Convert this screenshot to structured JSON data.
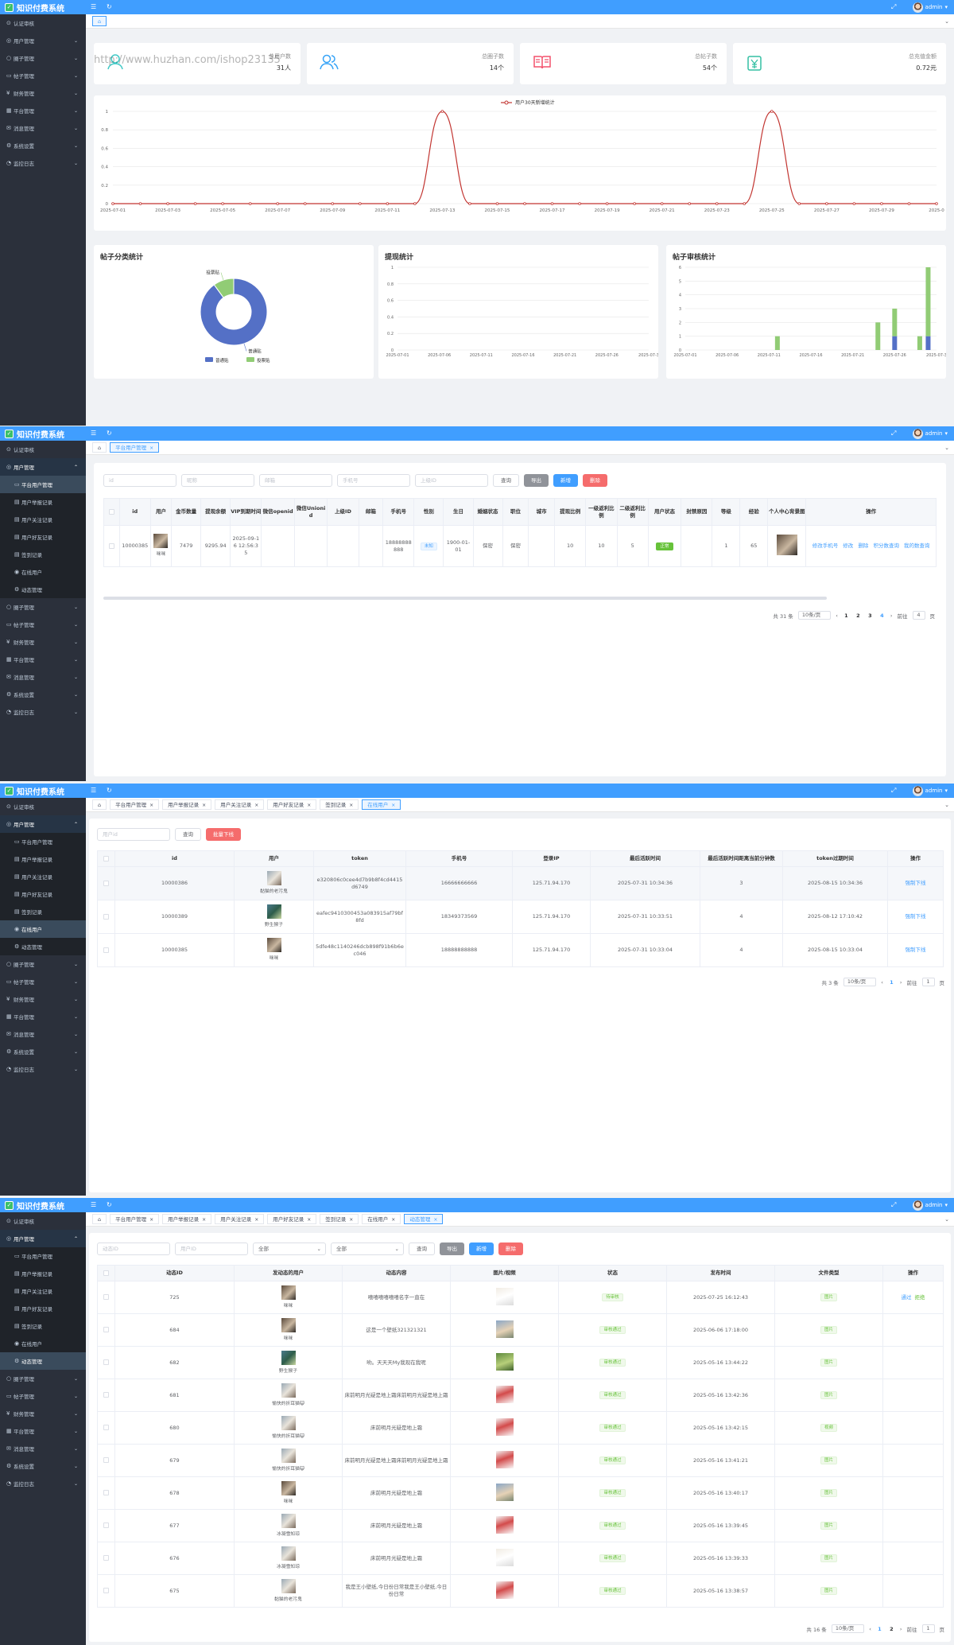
{
  "app": {
    "title": "知识付费系统",
    "user": "admin"
  },
  "menu": {
    "top": [
      "认证审核",
      "用户管理",
      "圈子管理",
      "帖子管理",
      "财务管理",
      "平台管理",
      "消息管理",
      "系统设置",
      "监控日志"
    ],
    "user_sub": [
      "平台用户管理",
      "用户举报记录",
      "用户关注记录",
      "用户好友记录",
      "签到记录",
      "在线用户",
      "动态管理"
    ]
  },
  "tabs": {
    "home_icon": "home-icon",
    "labels": [
      "平台用户管理",
      "用户举报记录",
      "用户关注记录",
      "用户好友记录",
      "签到记录",
      "在线用户",
      "动态管理"
    ]
  },
  "dashboard": {
    "stats": [
      {
        "label": "总用户数",
        "value": "31人",
        "icon": "user-icon",
        "color": "#40c9c6"
      },
      {
        "label": "总圈子数",
        "value": "14个",
        "icon": "users-icon",
        "color": "#36a3f7"
      },
      {
        "label": "总帖子数",
        "value": "54个",
        "icon": "book-icon",
        "color": "#f4516c"
      },
      {
        "label": "总充值金额",
        "value": "0.72元",
        "icon": "money-icon",
        "color": "#34bfa3"
      }
    ],
    "pie_title": "帖子分类统计",
    "withdraw_title": "提现统计",
    "audit_title": "帖子审核统计"
  },
  "chart_data": [
    {
      "type": "line",
      "legend": "用户30天新增统计",
      "x": [
        "2025-07-01",
        "2025-07-02",
        "2025-07-03",
        "2025-07-04",
        "2025-07-05",
        "2025-07-06",
        "2025-07-07",
        "2025-07-08",
        "2025-07-09",
        "2025-07-10",
        "2025-07-11",
        "2025-07-12",
        "2025-07-13",
        "2025-07-14",
        "2025-07-15",
        "2025-07-16",
        "2025-07-17",
        "2025-07-18",
        "2025-07-19",
        "2025-07-20",
        "2025-07-21",
        "2025-07-22",
        "2025-07-23",
        "2025-07-24",
        "2025-07-25",
        "2025-07-26",
        "2025-07-27",
        "2025-07-28",
        "2025-07-29",
        "2025-07-30",
        "2025-07-31"
      ],
      "x_tick_labels": [
        "2025-07-01",
        "2025-07-03",
        "2025-07-05",
        "2025-07-07",
        "2025-07-09",
        "2025-07-11",
        "2025-07-13",
        "2025-07-15",
        "2025-07-17",
        "2025-07-19",
        "2025-07-21",
        "2025-07-23",
        "2025-07-25",
        "2025-07-27",
        "2025-07-29",
        "2025-0"
      ],
      "values": [
        0,
        0,
        0,
        0,
        0,
        0,
        0,
        0,
        0,
        0,
        0,
        0,
        1,
        0,
        0,
        0,
        0,
        0,
        0,
        0,
        0,
        0,
        0,
        0,
        1,
        0,
        0,
        0,
        0,
        0,
        0
      ],
      "ylim": [
        0,
        1
      ],
      "y_ticks": [
        "0",
        "0.2",
        "0.4",
        "0.6",
        "0.8",
        "1"
      ],
      "color": "#c23531"
    },
    {
      "type": "pie",
      "labels": [
        "普通贴",
        "投票贴"
      ],
      "values": [
        90,
        10
      ],
      "colors": [
        "#5470c6",
        "#91cc75"
      ]
    },
    {
      "type": "line",
      "x_tick_labels": [
        "2025-07-01",
        "2025-07-06",
        "2025-07-11",
        "2025-07-16",
        "2025-07-21",
        "2025-07-26",
        "2025-07-3"
      ],
      "y_ticks": [
        "0",
        "0.2",
        "0.4",
        "0.6",
        "0.8",
        "1"
      ],
      "ylim": [
        0,
        1
      ],
      "values": []
    },
    {
      "type": "bar",
      "stacked": true,
      "x_tick_labels": [
        "2025-07-01",
        "2025-07-06",
        "2025-07-11",
        "2025-07-16",
        "2025-07-21",
        "2025-07-26",
        "2025-07-3"
      ],
      "categories_count": 31,
      "ylim": [
        0,
        6
      ],
      "y_ticks": [
        "0",
        "1",
        "2",
        "3",
        "4",
        "5",
        "6"
      ],
      "series": [
        {
          "color": "#5470c6",
          "points": [
            {
              "i": 25,
              "v": 1
            },
            {
              "i": 29,
              "v": 1
            }
          ]
        },
        {
          "color": "#91cc75",
          "points": [
            {
              "i": 11,
              "v": 1
            },
            {
              "i": 23,
              "v": 2
            },
            {
              "i": 25,
              "v": 2
            },
            {
              "i": 28,
              "v": 1
            },
            {
              "i": 29,
              "v": 5
            }
          ]
        }
      ]
    }
  ],
  "user_mgmt": {
    "placeholders": [
      "id",
      "昵称",
      "邮箱",
      "手机号",
      "上级ID"
    ],
    "buttons": {
      "query": "查询",
      "export": "导出",
      "add": "新增",
      "delete": "删除"
    },
    "columns": [
      "id",
      "用户",
      "金币数量",
      "提现余额",
      "VIP到期时间",
      "微信openid",
      "微信Unionid",
      "上级ID",
      "邮箱",
      "手机号",
      "性别",
      "生日",
      "婚姻状态",
      "职位",
      "城市",
      "提现比例",
      "一级返利比例",
      "二级返利比例",
      "用户状态",
      "封禁原因",
      "等级",
      "经验",
      "个人中心背景图",
      "操作"
    ],
    "row": {
      "id": "10000385",
      "nick": "咪咪",
      "coins": "7479",
      "balance": "9295.94",
      "vip": "2025-09-16 12:56:35",
      "phone": "18888888888",
      "gender": "未知",
      "birthday": "1900-01-01",
      "marriage": "保密",
      "job": "保密",
      "rate": "10",
      "rate1": "10",
      "rate2": "5",
      "status": "正常",
      "level": "1",
      "exp": "65"
    },
    "actions": [
      "修改手机号",
      "修改",
      "删除",
      "积分数查询",
      "我的数查询"
    ],
    "pager": {
      "total": "共 31 条",
      "size": "10条/页",
      "pages": [
        "1",
        "2",
        "3",
        "4"
      ],
      "goto": "前往",
      "page": "4",
      "unit": "页"
    }
  },
  "online": {
    "placeholder": "用户id",
    "buttons": {
      "query": "查询",
      "kick": "批量下线"
    },
    "columns": [
      "id",
      "用户",
      "token",
      "手机号",
      "登录IP",
      "最后活跃时间",
      "最后活跃时间距离当前分钟数",
      "token过期时间",
      "操作"
    ],
    "rows": [
      {
        "id": "10000386",
        "name": "黏猫的老污鬼",
        "token": "e320806c0cee4d7b9b8f4cd4415d6749",
        "phone": "16666666666",
        "ip": "125.71.94.170",
        "last": "2025-07-31 10:34:36",
        "mins": "3",
        "exp": "2025-08-15 10:34:36"
      },
      {
        "id": "10000389",
        "name": "野生猴子",
        "token": "eafec9410300453a083915af79bf8fd",
        "phone": "18349373569",
        "ip": "125.71.94.170",
        "last": "2025-07-31 10:33:51",
        "mins": "4",
        "exp": "2025-08-12 17:10:42"
      },
      {
        "id": "10000385",
        "name": "咪咪",
        "token": "5dfe48c1140246dcb898f91b6b6ec046",
        "phone": "18888888888",
        "ip": "125.71.94.170",
        "last": "2025-07-31 10:33:04",
        "mins": "4",
        "exp": "2025-08-15 10:33:04"
      }
    ],
    "action": "强制下线",
    "pager": {
      "total": "共 3 条",
      "size": "10条/页",
      "pages": [
        "1"
      ],
      "goto": "前往",
      "page": "1",
      "unit": "页"
    }
  },
  "dynamic": {
    "placeholders": [
      "动态ID",
      "用户ID"
    ],
    "selects": [
      "全部",
      "全部"
    ],
    "buttons": {
      "query": "查询",
      "export": "导出",
      "add": "新增",
      "delete": "删除"
    },
    "columns": [
      "动态ID",
      "发动态的用户",
      "动态内容",
      "图片/视频",
      "状态",
      "发布时间",
      "文件类型",
      "操作"
    ],
    "rows": [
      {
        "id": "725",
        "user": "咪咪",
        "text": "嘻嘻嘻嘻嘻嘻名字一直在",
        "status": "待审核",
        "time": "2025-07-25 16:12:43",
        "type": "图片",
        "ops": [
          "通过",
          "拒绝"
        ]
      },
      {
        "id": "684",
        "user": "咪咪",
        "text": "这是一个壁纸321321321",
        "status": "审核通过",
        "time": "2025-06-06 17:18:00",
        "type": "图片",
        "ops": []
      },
      {
        "id": "682",
        "user": "野生猴子",
        "text": "哟。天天天My我现在我呢",
        "status": "审核通过",
        "time": "2025-05-16 13:44:22",
        "type": "图片",
        "ops": []
      },
      {
        "id": "681",
        "user": "愉快的折耳猫😺",
        "text": "床前明月光疑是地上霜床前明月光疑是地上霜",
        "status": "审核通过",
        "time": "2025-05-16 13:42:36",
        "type": "图片",
        "ops": []
      },
      {
        "id": "680",
        "user": "愉快的折耳猫😺",
        "text": "床前明月光疑是地上霜",
        "status": "审核通过",
        "time": "2025-05-16 13:42:15",
        "type": "视频",
        "ops": []
      },
      {
        "id": "679",
        "user": "愉快的折耳猫😺",
        "text": "床前明月光疑是地上霜床前明月光疑是地上霜",
        "status": "审核通过",
        "time": "2025-05-16 13:41:21",
        "type": "图片",
        "ops": []
      },
      {
        "id": "678",
        "user": "咪咪",
        "text": "床前明月光疑是地上霜",
        "status": "审核通过",
        "time": "2025-05-16 13:40:17",
        "type": "图片",
        "ops": []
      },
      {
        "id": "677",
        "user": "冰凝雪知琼",
        "text": "床前明月光疑是地上霜",
        "status": "审核通过",
        "time": "2025-05-16 13:39:45",
        "type": "图片",
        "ops": []
      },
      {
        "id": "676",
        "user": "冰凝雪知琼",
        "text": "床前明月光疑是地上霜",
        "status": "审核通过",
        "time": "2025-05-16 13:39:33",
        "type": "图片",
        "ops": []
      },
      {
        "id": "675",
        "user": "黏猫的老污鬼",
        "text": "我是王小壁纸,今日份日常我是王小壁纸,今日份日常",
        "status": "审核通过",
        "time": "2025-05-16 13:38:57",
        "type": "图片",
        "ops": []
      }
    ],
    "pager": {
      "total": "共 16 条",
      "size": "10条/页",
      "pages": [
        "1",
        "2"
      ],
      "goto": "前往",
      "page": "1",
      "unit": "页"
    }
  },
  "watermark": "http://www.huzhan.com/ishop23135"
}
